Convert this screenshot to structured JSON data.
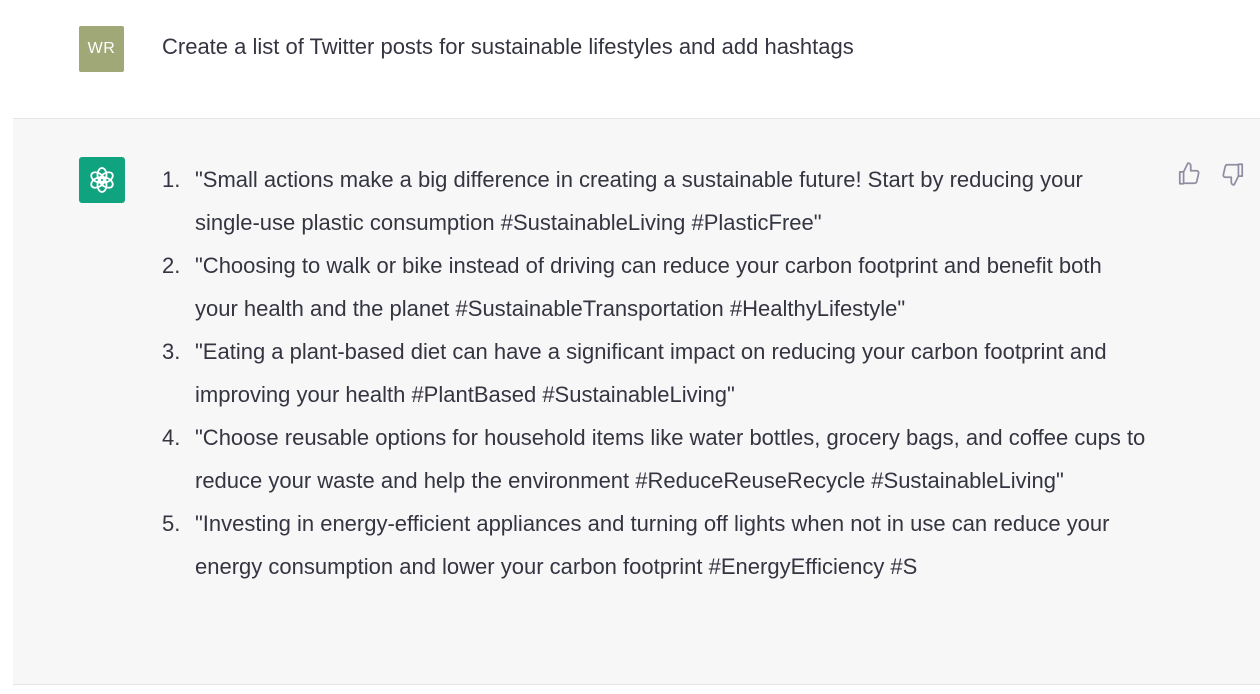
{
  "user": {
    "avatar_initials": "WR",
    "message": "Create a list of Twitter posts for sustainable lifestyles and add hashtags"
  },
  "assistant": {
    "icon": "openai-logo-icon",
    "items": [
      {
        "number": "1.",
        "text": "\"Small actions make a big difference in creating a sustainable future! Start by reducing your single-use plastic consumption #SustainableLiving #PlasticFree\""
      },
      {
        "number": "2.",
        "text": "\"Choosing to walk or bike instead of driving can reduce your carbon footprint and benefit both your health and the planet #SustainableTransportation #HealthyLifestyle\""
      },
      {
        "number": "3.",
        "text": "\"Eating a plant-based diet can have a significant impact on reducing your carbon footprint and improving your health #PlantBased #SustainableLiving\""
      },
      {
        "number": "4.",
        "text": "\"Choose reusable options for household items like water bottles, grocery bags, and coffee cups to reduce your waste and help the environment #ReduceReuseRecycle #SustainableLiving\""
      },
      {
        "number": "5.",
        "text": "\"Investing in energy-efficient appliances and turning off lights when not in use can reduce your energy consumption and lower your carbon footprint #EnergyEfficiency #S"
      }
    ]
  },
  "feedback": {
    "thumbs_up_icon": "thumbs-up-icon",
    "thumbs_down_icon": "thumbs-down-icon"
  },
  "colors": {
    "user_avatar_bg": "#a0a878",
    "assistant_avatar_bg": "#10a37f",
    "assistant_row_bg": "#f7f7f8",
    "text": "#343541"
  }
}
